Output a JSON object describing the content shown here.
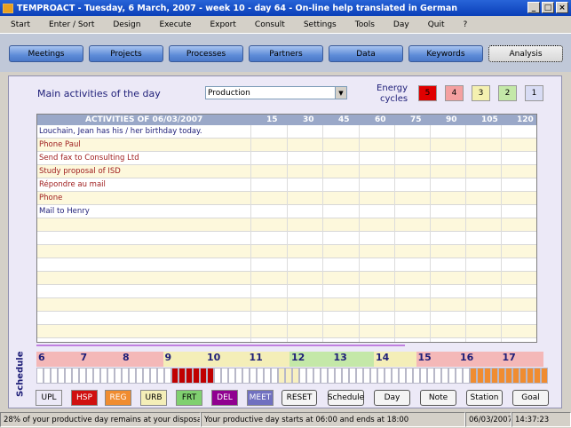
{
  "window": {
    "title": "TEMPROACT - Tuesday, 6 March, 2007 - week 10 - day 64 - On-line help translated in German"
  },
  "menu": [
    "Start",
    "Enter / Sort",
    "Design",
    "Execute",
    "Export",
    "Consult",
    "Settings",
    "Tools",
    "Day",
    "Quit",
    "?"
  ],
  "tabs": [
    "Meetings",
    "Projects",
    "Processes",
    "Partners",
    "Data",
    "Keywords",
    "Analysis"
  ],
  "active_tab": "Analysis",
  "main": {
    "label": "Main activities of the day",
    "dropdown_value": "Production",
    "energy_label_line1": "Energy",
    "energy_label_line2": "cycles",
    "cycles": [
      {
        "label": "5",
        "color": "#e00000",
        "text": "#000"
      },
      {
        "label": "4",
        "color": "#f4a0a0",
        "text": "#000"
      },
      {
        "label": "3",
        "color": "#f4f0b0",
        "text": "#000"
      },
      {
        "label": "2",
        "color": "#c4e8a8",
        "text": "#000"
      },
      {
        "label": "1",
        "color": "#d8dcf4",
        "text": "#000"
      }
    ]
  },
  "grid": {
    "header": "ACTIVITIES OF  06/03/2007",
    "columns": [
      "15",
      "30",
      "45",
      "60",
      "75",
      "90",
      "105",
      "120"
    ],
    "rows": [
      {
        "text": "Louchain, Jean has his / her birthday today.",
        "color": "#1e1e78"
      },
      {
        "text": "Phone Paul",
        "color": "#a02020"
      },
      {
        "text": "Send fax to Consulting Ltd",
        "color": "#a02020"
      },
      {
        "text": "Study proposal of ISD",
        "color": "#a02020"
      },
      {
        "text": "Répondre au mail",
        "color": "#a02020"
      },
      {
        "text": "Phone",
        "color": "#a02020"
      },
      {
        "text": "Mail to Henry",
        "color": "#1e1e78"
      }
    ]
  },
  "schedule": {
    "label": "Schedule",
    "hours": [
      {
        "h": "6",
        "bg": "#f4b8b8"
      },
      {
        "h": "7",
        "bg": "#f4b8b8"
      },
      {
        "h": "8",
        "bg": "#f4b8b8"
      },
      {
        "h": "9",
        "bg": "#f4eeb8"
      },
      {
        "h": "10",
        "bg": "#f4eeb8"
      },
      {
        "h": "11",
        "bg": "#f4eeb8"
      },
      {
        "h": "12",
        "bg": "#c4e8a8"
      },
      {
        "h": "13",
        "bg": "#c4e8a8"
      },
      {
        "h": "14",
        "bg": "#f4eeb8"
      },
      {
        "h": "15",
        "bg": "#f4b8b8"
      },
      {
        "h": "16",
        "bg": "#f4b8b8"
      },
      {
        "h": "17",
        "bg": "#f4b8b8"
      }
    ]
  },
  "categories": [
    {
      "label": "UPL",
      "bg": "#ece9f7",
      "fg": "#000"
    },
    {
      "label": "HSP",
      "bg": "#d01010",
      "fg": "#fff"
    },
    {
      "label": "REG",
      "bg": "#f08c30",
      "fg": "#fff"
    },
    {
      "label": "URB",
      "bg": "#f4eeb8",
      "fg": "#000"
    },
    {
      "label": "FRT",
      "bg": "#80d070",
      "fg": "#000"
    },
    {
      "label": "DEL",
      "bg": "#900090",
      "fg": "#fff"
    },
    {
      "label": "MEET",
      "bg": "#7070c0",
      "fg": "#fff"
    }
  ],
  "actions": [
    "RESET",
    "Schedule",
    "Day",
    "Note",
    "Station",
    "Goal"
  ],
  "status": {
    "left": "28% of your productive day remains at your disposal.",
    "middle": "Your productive day starts at 06:00 and ends at 18:00",
    "date": "06/03/2007",
    "time": "14:37:23"
  }
}
